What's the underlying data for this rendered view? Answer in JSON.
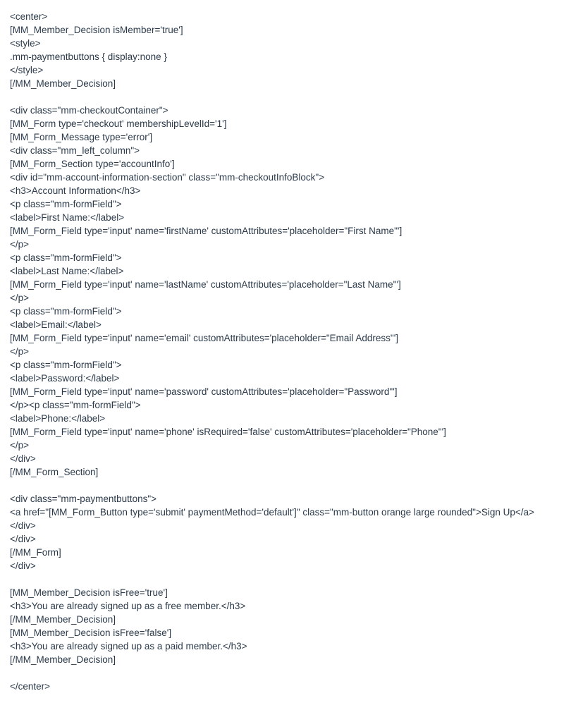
{
  "code": {
    "lines": [
      "<center>",
      "[MM_Member_Decision isMember='true']",
      "<style>",
      ".mm-paymentbuttons { display:none }",
      "</style>",
      "[/MM_Member_Decision]",
      "",
      "<div class=\"mm-checkoutContainer\">",
      "[MM_Form type='checkout' membershipLevelId='1']",
      "[MM_Form_Message type='error']",
      "<div class=\"mm_left_column\">",
      "[MM_Form_Section type='accountInfo']",
      "<div id=\"mm-account-information-section\" class=\"mm-checkoutInfoBlock\">",
      "<h3>Account Information</h3>",
      "<p class=\"mm-formField\">",
      "<label>First Name:</label>",
      "[MM_Form_Field type='input' name='firstName' customAttributes='placeholder=\"First Name\"']",
      "</p>",
      "<p class=\"mm-formField\">",
      "<label>Last Name:</label>",
      "[MM_Form_Field type='input' name='lastName' customAttributes='placeholder=\"Last Name\"']",
      "</p>",
      "<p class=\"mm-formField\">",
      "<label>Email:</label>",
      "[MM_Form_Field type='input' name='email' customAttributes='placeholder=\"Email Address\"']",
      "</p>",
      "<p class=\"mm-formField\">",
      "<label>Password:</label>",
      "[MM_Form_Field type='input' name='password' customAttributes='placeholder=\"Password\"']",
      "</p><p class=\"mm-formField\">",
      "<label>Phone:</label>",
      "[MM_Form_Field type='input' name='phone' isRequired='false' customAttributes='placeholder=\"Phone\"']",
      "</p>",
      "</div>",
      "[/MM_Form_Section]",
      "",
      "<div class=\"mm-paymentbuttons\">",
      "<a href=\"[MM_Form_Button type='submit' paymentMethod='default']\" class=\"mm-button orange large rounded\">Sign Up</a>",
      "</div>",
      "</div>",
      "[/MM_Form]",
      "</div>",
      "",
      "[MM_Member_Decision isFree='true']",
      "<h3>You are already signed up as a free member.</h3>",
      "[/MM_Member_Decision]",
      "[MM_Member_Decision isFree='false']",
      "<h3>You are already signed up as a paid member.</h3>",
      "[/MM_Member_Decision]",
      "",
      "</center>"
    ]
  }
}
